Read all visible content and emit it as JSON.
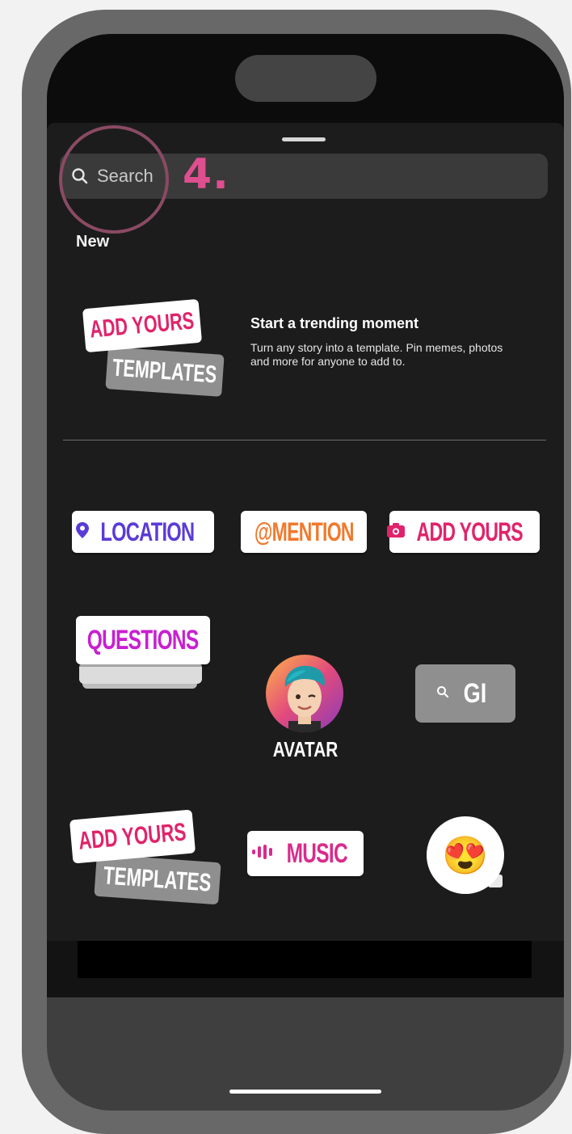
{
  "search": {
    "placeholder": "Search"
  },
  "annotation": {
    "step": "4."
  },
  "sections": {
    "new_title": "New"
  },
  "trending": {
    "sticker_top": "ADD YOURS",
    "sticker_bottom": "TEMPLATES",
    "title": "Start a trending moment",
    "description": "Turn any story into a template. Pin memes, photos and more for anyone to add to."
  },
  "stickers": {
    "location": "LOCATION",
    "mention": "@MENTION",
    "add_yours": "ADD YOURS",
    "questions": "QUESTIONS",
    "avatar": "AVATAR",
    "gif": "GI",
    "add_yours_templates_top": "ADD YOURS",
    "add_yours_templates_bottom": "TEMPLATES",
    "music": "MUSIC",
    "emoji": "😍"
  },
  "colors": {
    "location": "#5b3bd6",
    "mention": "#f07a2c",
    "add_yours": "#e0246b",
    "questions": "#c81fd1",
    "music": "#d92b8c",
    "step": "#de4f8f"
  },
  "icons": {
    "search": "search-icon",
    "location": "location-pin-icon",
    "add_yours": "camera-icon",
    "music": "sound-wave-icon",
    "gif_search": "search-icon"
  }
}
